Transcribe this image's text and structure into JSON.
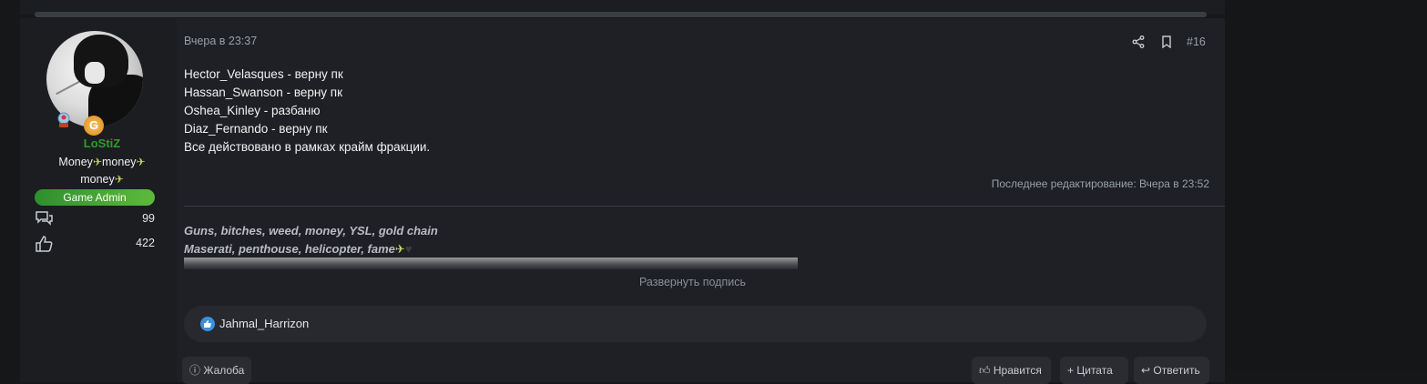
{
  "post": {
    "user": {
      "username": "LoStiZ",
      "title_line1": "Money",
      "title_line2": "money",
      "title_line3": "money",
      "role": "Game Admin",
      "messages_count": "99",
      "reactions_count": "422",
      "badge2_letter": "G"
    },
    "date": "Вчера в 23:37",
    "post_number": "#16",
    "content": [
      "Hector_Velasques - верну пк",
      "Hassan_Swanson - верну пк",
      "Oshea_Kinley - разбаню",
      "Diaz_Fernando - верну пк",
      "Все действовано в рамках крайм фракции."
    ],
    "last_edited": "Последнее редактирование: Вчера в 23:52",
    "signature": {
      "line1": "Guns, bitches, weed, money, YSL, gold chain",
      "line2": "Maserati, penthouse, helicopter, fame",
      "expand_label": "Развернуть подпись"
    },
    "reactions": {
      "users": "Jahmal_Harrizon"
    },
    "actions": {
      "report": "Жалоба",
      "like": "Нравится",
      "quote": "Цитата",
      "reply": "Ответить"
    }
  },
  "colors": {
    "username": "#2aa02a",
    "role_badge": "#4aa83a",
    "reaction": "#3b8fde"
  }
}
